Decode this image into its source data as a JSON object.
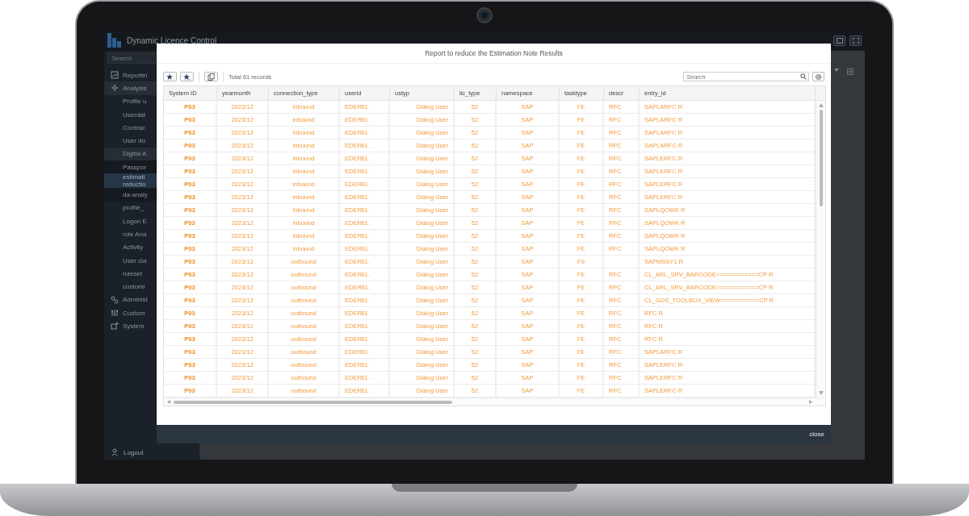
{
  "app": {
    "title": "Dynamic Licence Control",
    "search_placeholder": "Search"
  },
  "sidebar": {
    "items": [
      {
        "label": "Reportin",
        "selected": false
      },
      {
        "label": "Analysis",
        "selected": false,
        "expanded": true,
        "children": [
          {
            "label": "Profile u",
            "selected": false
          },
          {
            "label": "Userdat",
            "selected": false
          },
          {
            "label": "Contrac",
            "selected": false
          },
          {
            "label": "User du",
            "selected": false
          },
          {
            "label": "Digital A",
            "selected": false,
            "expanded": true,
            "children": [
              {
                "label": "Passpor",
                "selected": false
              },
              {
                "label": "estimati\nreductio",
                "selected": true
              },
              {
                "label": "da-analy",
                "selected": false
              }
            ]
          },
          {
            "label": "profile_",
            "selected": false
          },
          {
            "label": "Logon E",
            "selected": false
          },
          {
            "label": "role Ana",
            "selected": false
          },
          {
            "label": "Activity",
            "selected": false
          },
          {
            "label": "User cla",
            "selected": false
          },
          {
            "label": "ruleset",
            "selected": false
          },
          {
            "label": "customi",
            "selected": false
          }
        ]
      },
      {
        "label": "Administ",
        "selected": false
      },
      {
        "label": "Custom",
        "selected": false
      },
      {
        "label": "System",
        "selected": false
      }
    ],
    "logout": "Logout"
  },
  "dialog": {
    "title": "Report to reduce the Estimation Note Results",
    "record_count": "Total 61 records",
    "search_placeholder": "Search",
    "columns": [
      "System ID",
      "yearmonth",
      "connection_type",
      "userid",
      "ustyp",
      "lic_type",
      "namespace",
      "tasktype",
      "descr",
      "entry_id"
    ],
    "rows": [
      [
        "P03",
        "2023/12",
        "inbound",
        "EDEREL",
        "Dialog User",
        "52",
        "SAP",
        "FE",
        "RFC",
        "SAPLARFC R"
      ],
      [
        "P03",
        "2023/12",
        "inbound",
        "EDEREL",
        "Dialog User",
        "52",
        "SAP",
        "FE",
        "RFC",
        "SAPLARFC R"
      ],
      [
        "P03",
        "2023/12",
        "inbound",
        "EDEREL",
        "Dialog User",
        "52",
        "SAP",
        "FE",
        "RFC",
        "SAPLARFC R"
      ],
      [
        "P03",
        "2023/12",
        "inbound",
        "EDEREL",
        "Dialog User",
        "52",
        "SAP",
        "FE",
        "RFC",
        "SAPLARFC R"
      ],
      [
        "P03",
        "2023/12",
        "inbound",
        "EDEREL",
        "Dialog User",
        "52",
        "SAP",
        "FE",
        "RFC",
        "SAPLERFC R"
      ],
      [
        "P03",
        "2023/12",
        "inbound",
        "EDEREL",
        "Dialog User",
        "52",
        "SAP",
        "FE",
        "RFC",
        "SAPLERFC R"
      ],
      [
        "P03",
        "2023/12",
        "inbound",
        "EDEREL",
        "Dialog User",
        "52",
        "SAP",
        "FE",
        "RFC",
        "SAPLERFC R"
      ],
      [
        "P03",
        "2023/12",
        "inbound",
        "EDEREL",
        "Dialog User",
        "52",
        "SAP",
        "FE",
        "RFC",
        "SAPLERFC R"
      ],
      [
        "P03",
        "2023/12",
        "inbound",
        "EDEREL",
        "Dialog User",
        "52",
        "SAP",
        "FE",
        "RFC",
        "SAPLQOWK R"
      ],
      [
        "P03",
        "2023/12",
        "inbound",
        "EDEREL",
        "Dialog User",
        "52",
        "SAP",
        "FE",
        "RFC",
        "SAPLQOWK R"
      ],
      [
        "P03",
        "2023/12",
        "inbound",
        "EDEREL",
        "Dialog User",
        "52",
        "SAP",
        "FE",
        "RFC",
        "SAPLQOWK R"
      ],
      [
        "P03",
        "2023/12",
        "inbound",
        "EDEREL",
        "Dialog User",
        "52",
        "SAP",
        "FE",
        "RFC",
        "SAPLQOWK R"
      ],
      [
        "P03",
        "2023/12",
        "outbound",
        "EDEREL",
        "Dialog User",
        "52",
        "SAP",
        "F9",
        null,
        "SAPMSSY1 R"
      ],
      [
        "P03",
        "2023/12",
        "outbound",
        "EDEREL",
        "Dialog User",
        "52",
        "SAP",
        "FE",
        "RFC",
        "CL_ARL_SRV_BARCODE============CP R"
      ],
      [
        "P03",
        "2023/12",
        "outbound",
        "EDEREL",
        "Dialog User",
        "52",
        "SAP",
        "FE",
        "RFC",
        "CL_ARL_SRV_BARCODE============CP R"
      ],
      [
        "P03",
        "2023/12",
        "outbound",
        "EDEREL",
        "Dialog User",
        "52",
        "SAP",
        "FE",
        "RFC",
        "CL_GOS_TOOLBOX_VIEW===========CP R"
      ],
      [
        "P03",
        "2023/12",
        "outbound",
        "EDEREL",
        "Dialog User",
        "52",
        "SAP",
        "FE",
        "RFC",
        "RFC R"
      ],
      [
        "P03",
        "2023/12",
        "outbound",
        "EDEREL",
        "Dialog User",
        "52",
        "SAP",
        "FE",
        "RFC",
        "RFC R"
      ],
      [
        "P03",
        "2023/12",
        "outbound",
        "EDEREL",
        "Dialog User",
        "52",
        "SAP",
        "FE",
        "RFC",
        "RFC R"
      ],
      [
        "P03",
        "2023/12",
        "outbound",
        "EDEREL",
        "Dialog User",
        "52",
        "SAP",
        "FE",
        "RFC",
        "SAPLARFC R"
      ],
      [
        "P03",
        "2023/12",
        "outbound",
        "EDEREL",
        "Dialog User",
        "52",
        "SAP",
        "FE",
        "RFC",
        "SAPLERFC R"
      ],
      [
        "P03",
        "2023/12",
        "outbound",
        "EDEREL",
        "Dialog User",
        "52",
        "SAP",
        "FE",
        "RFC",
        "SAPLERFC R"
      ],
      [
        "P03",
        "2023/12",
        "outbound",
        "EDEREL",
        "Dialog User",
        "52",
        "SAP",
        "FE",
        "RFC",
        "SAPLERFC R"
      ]
    ],
    "close_button": "close"
  }
}
